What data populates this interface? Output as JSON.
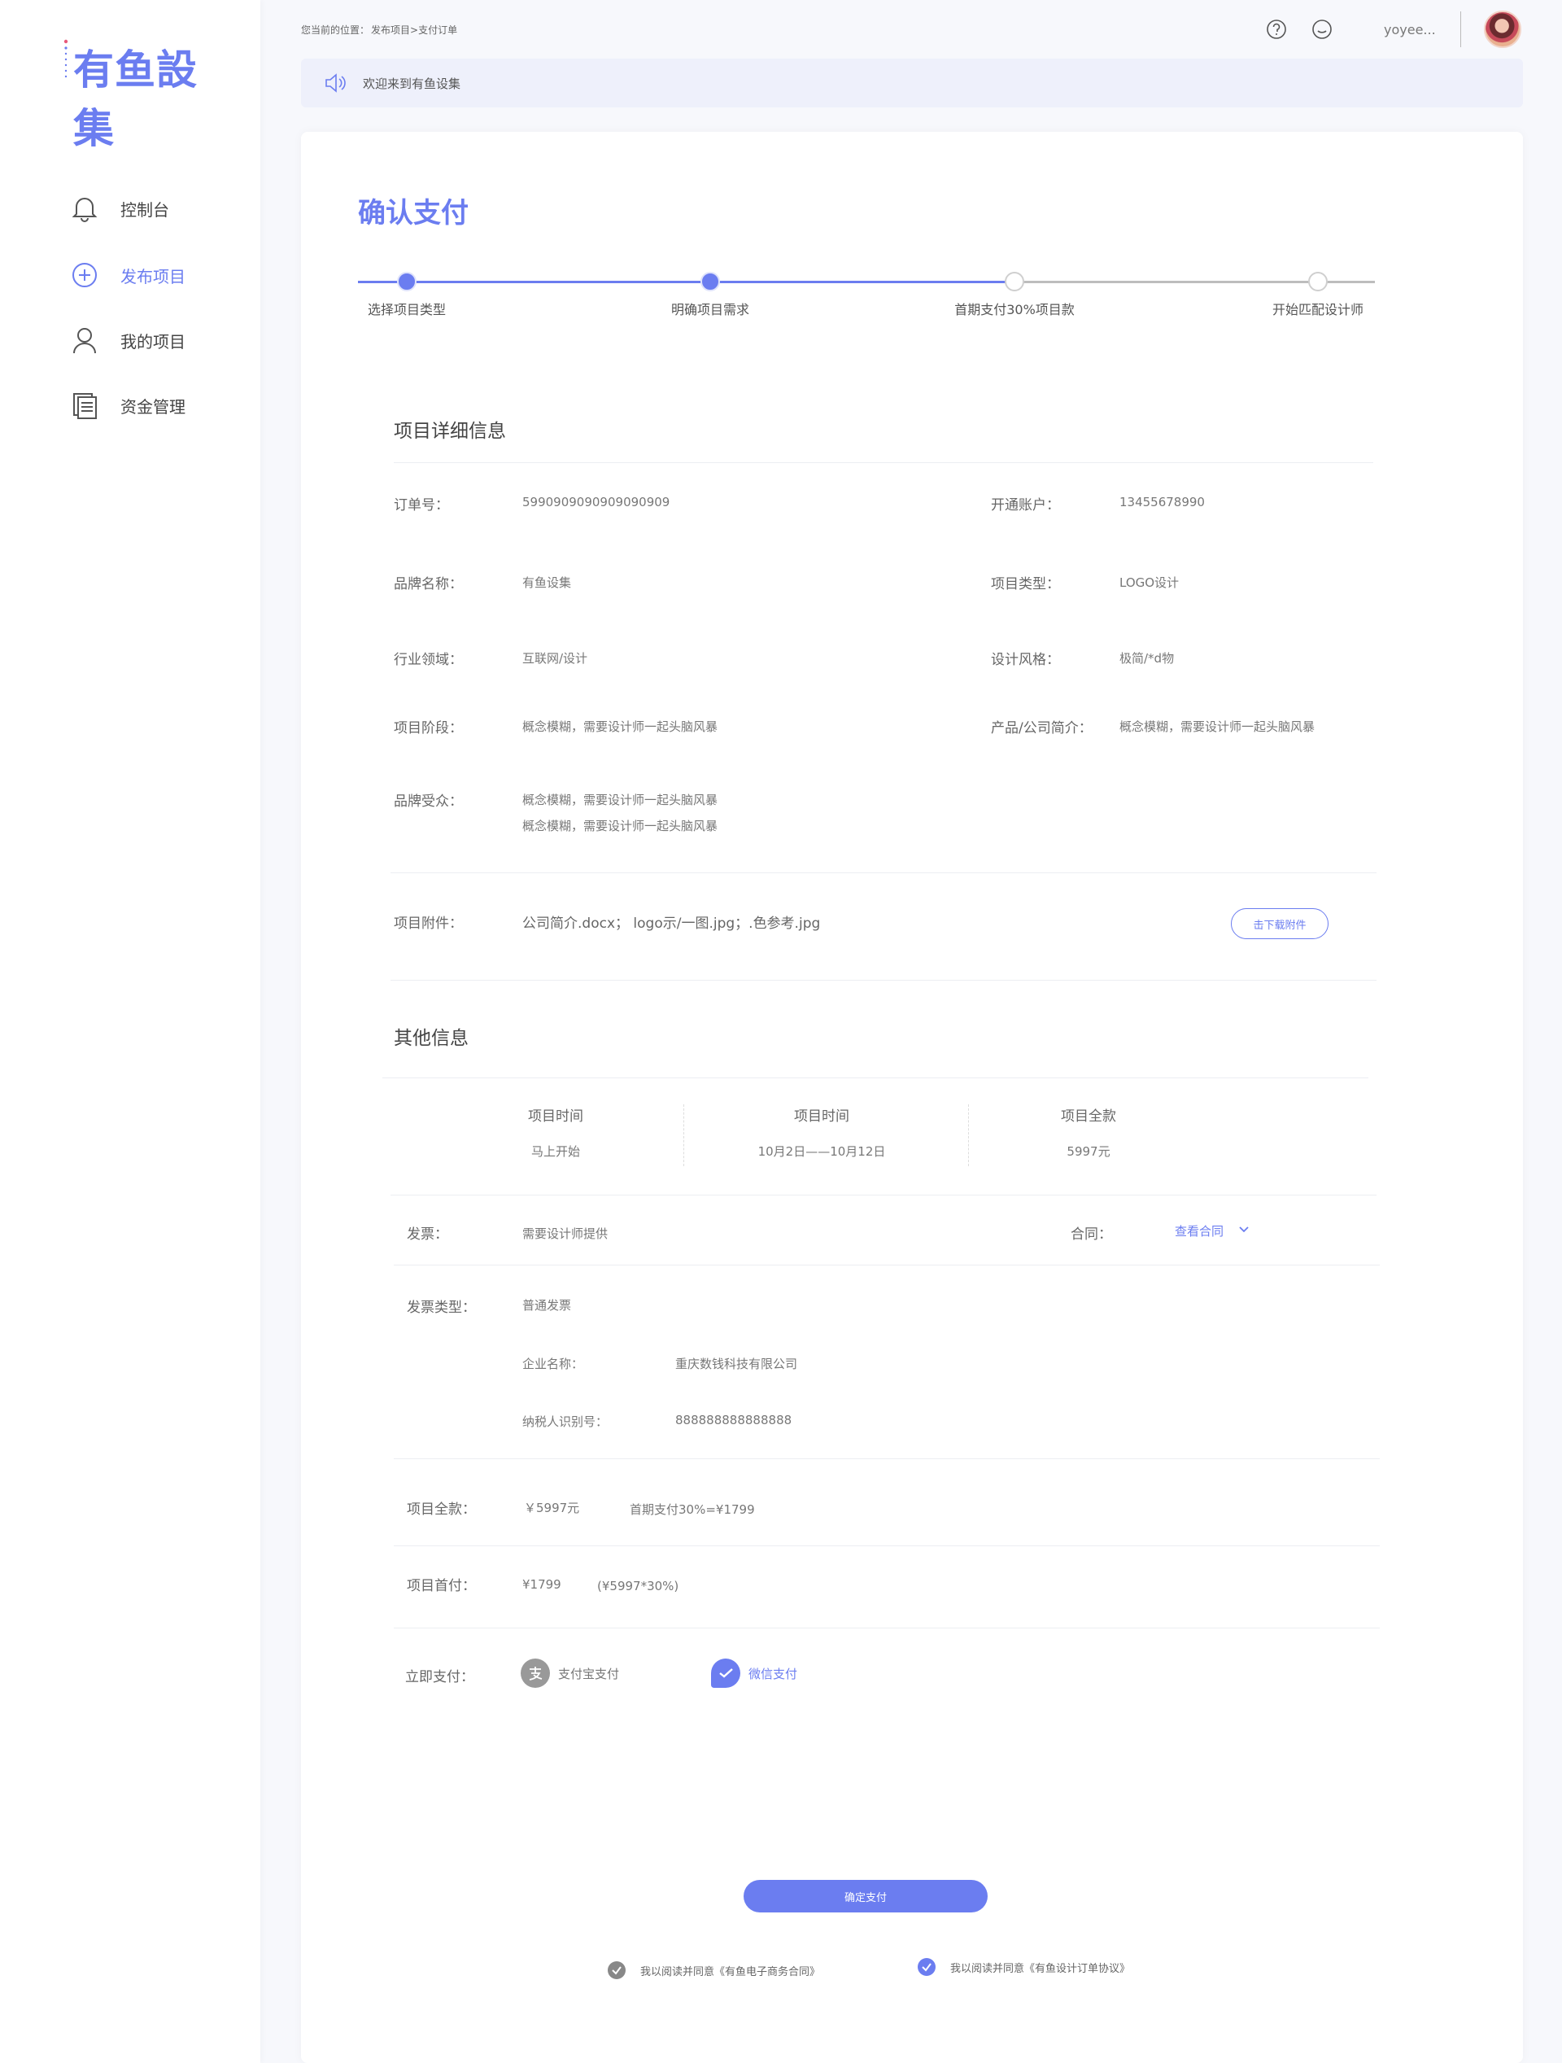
{
  "brand": {
    "logo_text": "有鱼設集",
    "accent": "#6b7df0"
  },
  "sidebar": {
    "items": [
      {
        "label": "控制台",
        "icon": "bell-icon",
        "active": false
      },
      {
        "label": "发布项目",
        "icon": "plus-circle-icon",
        "active": true
      },
      {
        "label": "我的项目",
        "icon": "user-icon",
        "active": false
      },
      {
        "label": "资金管理",
        "icon": "document-stack-icon",
        "active": false
      }
    ]
  },
  "header": {
    "breadcrumb_prefix": "您当前的位置：",
    "breadcrumb_path": "发布项目>支付订单",
    "username": "yoyee...",
    "icons": [
      "help-icon",
      "message-icon"
    ]
  },
  "notice": {
    "text": "欢迎来到有鱼设集"
  },
  "page": {
    "title": "确认支付"
  },
  "steps": [
    {
      "label": "选择项目类型",
      "done": true
    },
    {
      "label": "明确项目需求",
      "done": true
    },
    {
      "label": "首期支付30%项目款",
      "done": false
    },
    {
      "label": "开始匹配设计师",
      "done": false
    }
  ],
  "details": {
    "title": "项目详细信息",
    "order_no_label": "订单号：",
    "order_no": "5990909090909090909",
    "account_label": "开通账户：",
    "account": "13455678990",
    "brand_label": "品牌名称：",
    "brand_value": "有鱼设集",
    "type_label": "项目类型：",
    "type_value": "LOGO设计",
    "industry_label": "行业领域：",
    "industry_value": "互联网/设计",
    "style_label": "设计风格：",
    "style_value": "极简/*d物",
    "stage_label": "项目阶段：",
    "stage_value": "概念模糊，需要设计师一起头脑风暴",
    "intro_label": "产品/公司简介：",
    "intro_value": "概念模糊，需要设计师一起头脑风暴",
    "audience_label": "品牌受众：",
    "audience_line1": "概念模糊，需要设计师一起头脑风暴",
    "audience_line2": "概念模糊，需要设计师一起头脑风暴",
    "attach_label": "项目附件：",
    "attach_value": "公司简介.docx； logo示/一图.jpg；.色参考.jpg",
    "download_label": "击下载附件"
  },
  "other": {
    "title": "其他信息",
    "stats": [
      {
        "head": "项目时间",
        "value": "马上开始"
      },
      {
        "head": "项目时间",
        "value": "10月2日——10月12日"
      },
      {
        "head": "项目全款",
        "value": "5997元"
      }
    ],
    "invoice_label": "发票：",
    "invoice_value": "需要设计师提供",
    "contract_label": "合同：",
    "contract_link": "查看合同",
    "invoice_type_label": "发票类型：",
    "invoice_type_value": "普通发票",
    "company_label": "企业名称：",
    "company_value": "重庆数钱科技有限公司",
    "taxid_label": "纳税人识别号：",
    "taxid_value": "888888888888888",
    "total_label": "项目全款：",
    "total_value": "￥5997元",
    "first_pay_note": "首期支付30%=¥1799",
    "down_label": "项目首付：",
    "down_value": "¥1799",
    "down_formula": "(¥5997*30%)",
    "pay_label": "立即支付：",
    "alipay_label": "支付宝支付",
    "wechat_label": "微信支付"
  },
  "footer": {
    "confirm_label": "确定支付",
    "agree1": "我以阅读并同意《有鱼电子商务合同》",
    "agree2": "我以阅读并同意《有鱼设计订单协议》"
  }
}
